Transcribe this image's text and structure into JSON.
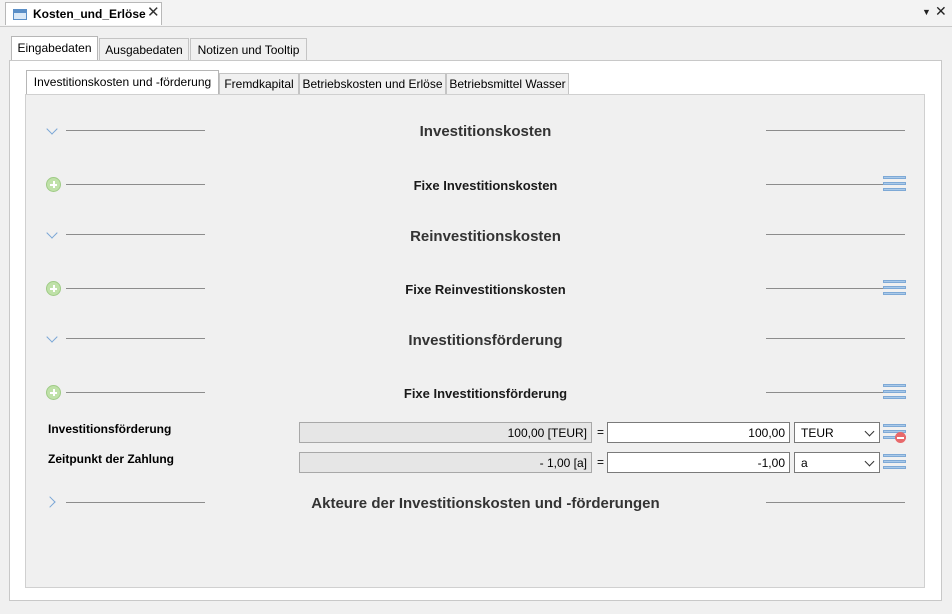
{
  "editor": {
    "tab_title": "Kosten_und_Erlöse",
    "close_symbol": "✕",
    "menu_symbol": "▼",
    "view_close_symbol": "✕"
  },
  "outer_tabs": [
    {
      "label": "Eingabedaten",
      "active": true
    },
    {
      "label": "Ausgabedaten",
      "active": false
    },
    {
      "label": "Notizen und Tooltip",
      "active": false
    }
  ],
  "inner_tabs": [
    {
      "label": "Investitionskosten und -förderung",
      "active": true
    },
    {
      "label": "Fremdkapital",
      "active": false
    },
    {
      "label": "Betriebskosten und Erlöse",
      "active": false
    },
    {
      "label": "Betriebsmittel Wasser",
      "active": false
    }
  ],
  "sections": {
    "investitionskosten": "Investitionskosten",
    "fixe_investitionskosten": "Fixe Investitionskosten",
    "reinvestitionskosten": "Reinvestitionskosten",
    "fixe_reinvestitionskosten": "Fixe Reinvestitionskosten",
    "investitionsfoerderung": "Investitionsförderung",
    "fixe_investitionsfoerderung": "Fixe Investitionsförderung",
    "akteure": "Akteure der Investitionskosten und -förderungen"
  },
  "fields": [
    {
      "label": "Investitionsförderung",
      "computed": "100,00 [TEUR]",
      "equals": "=",
      "value": "100,00",
      "unit": "TEUR"
    },
    {
      "label": "Zeitpunkt der Zahlung",
      "computed": "- 1,00 [a]",
      "equals": "=",
      "value": "-1,00",
      "unit": "a"
    }
  ],
  "icons": {
    "expand": "chevron-down-icon",
    "collapse": "chevron-right-icon",
    "add": "plus-circle-icon",
    "list": "list-icon",
    "remove": "remove-icon"
  },
  "colors": {
    "accent": "#7aa6d6",
    "add_green": "#bfe1a8",
    "remove_red": "#e8696b",
    "panel_bg": "#f0f0f0"
  }
}
